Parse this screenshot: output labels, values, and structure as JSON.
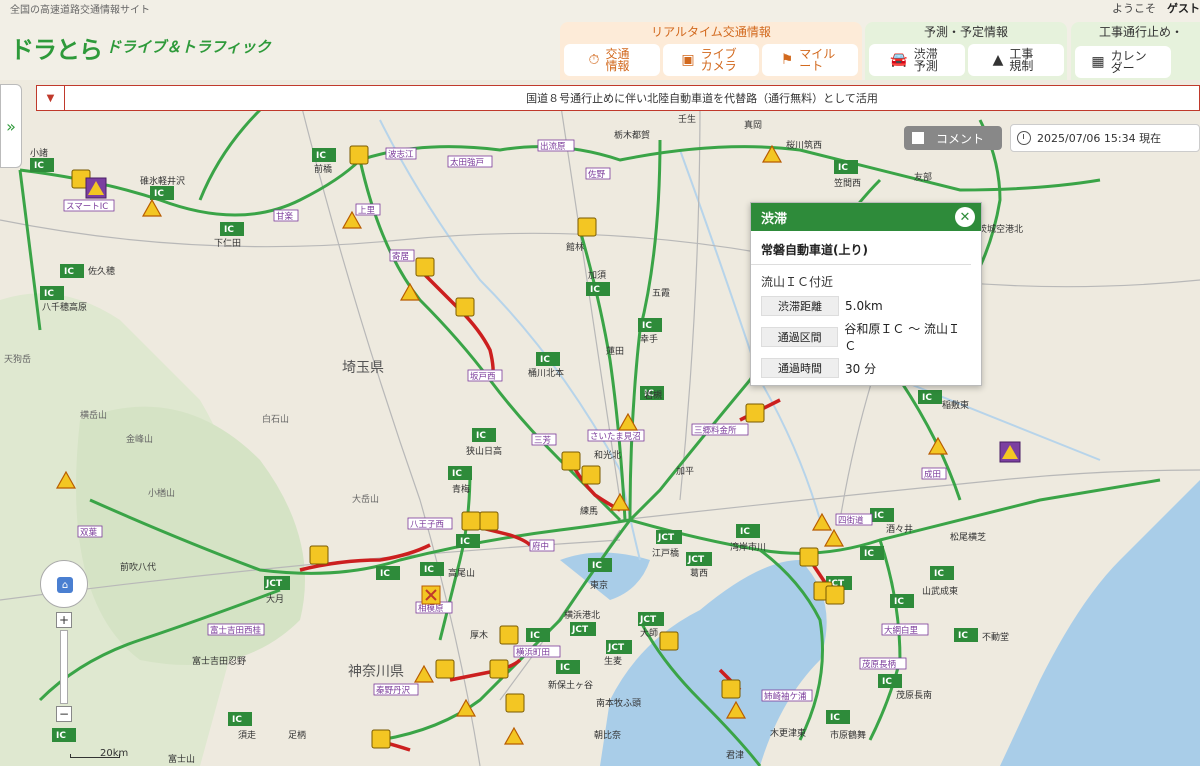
{
  "site": {
    "tagline": "全国の高速道路交通情報サイト",
    "welcome": "ようこそ",
    "guest": "ゲスト",
    "logo": "ドラとら",
    "logo_sub": "ドライブ＆トラフィック"
  },
  "nav": {
    "realtime": {
      "title": "リアルタイム交通情報",
      "items": [
        "交通情報",
        "ライブカメラ",
        "マイルート"
      ]
    },
    "forecast": {
      "title": "予測・予定情報",
      "items": [
        "渋滞予測",
        "工事規制"
      ]
    },
    "closure": {
      "title": "工事通行止め・",
      "items": [
        "カレンダー"
      ]
    }
  },
  "ticker": {
    "text": "国道８号通行止めに伴い北陸自動車道を代替路（通行無料）として活用"
  },
  "controls": {
    "comment_label": "コメント",
    "datetime": "2025/07/06 15:34 現在"
  },
  "popup": {
    "header": "渋滞",
    "road": "常磐自動車道(上り)",
    "location": "流山ＩＣ付近",
    "rows": [
      {
        "key": "渋滞距離",
        "value": "5.0km"
      },
      {
        "key": "通過区間",
        "value": "谷和原ＩＣ 〜 流山ＩＣ"
      },
      {
        "key": "通過時間",
        "value": "30 分"
      }
    ]
  },
  "map": {
    "prefectures": [
      "埼玉県",
      "神奈川県"
    ],
    "scale": "20km",
    "ic_labels": [
      {
        "name": "スマートIC",
        "sub": "PA"
      },
      {
        "name": "波志江",
        "sub": "PA"
      },
      {
        "name": "太田強戸",
        "sub": "PA"
      },
      {
        "name": "出流原",
        "sub": "スマートIC"
      },
      {
        "name": "佐野",
        "sub": "スマートIC"
      },
      {
        "name": "上里",
        "sub": "SA"
      },
      {
        "name": "寄居",
        "sub": "PA"
      },
      {
        "name": "甘楽",
        "sub": "スマートIC"
      },
      {
        "name": "坂戸西",
        "sub": "スマートIC"
      },
      {
        "name": "三芳",
        "sub": "SA"
      },
      {
        "name": "八王子西",
        "sub": ""
      },
      {
        "name": "相模原",
        "sub": ""
      },
      {
        "name": "府中",
        "sub": "スマートIC"
      },
      {
        "name": "横浜町田",
        "sub": ""
      },
      {
        "name": "さいたま見沼",
        "sub": ""
      },
      {
        "name": "三郷料金所",
        "sub": "スマートIC"
      },
      {
        "name": "成田",
        "sub": "スマートIC"
      },
      {
        "name": "四街道",
        "sub": ""
      },
      {
        "name": "大網白里",
        "sub": "スマートIC"
      },
      {
        "name": "茂原長柄",
        "sub": "スマートIC"
      },
      {
        "name": "姉崎袖ケ浦",
        "sub": ""
      },
      {
        "name": "富士吉田西桂",
        "sub": "スマートIC"
      },
      {
        "name": "双葉",
        "sub": "SA"
      },
      {
        "name": "秦野丹沢",
        "sub": "スマートIC"
      },
      {
        "name": "前橋",
        "sub": ""
      },
      {
        "name": "下仁田",
        "sub": ""
      },
      {
        "name": "佐久穂",
        "sub": ""
      },
      {
        "name": "八千穂高原",
        "sub": ""
      },
      {
        "name": "碓氷軽井沢",
        "sub": ""
      },
      {
        "name": "小諸",
        "sub": ""
      },
      {
        "name": "館林",
        "sub": ""
      },
      {
        "name": "加須",
        "sub": ""
      },
      {
        "name": "五霞",
        "sub": ""
      },
      {
        "name": "幸手",
        "sub": ""
      },
      {
        "name": "蓮田",
        "sub": "SA"
      },
      {
        "name": "桶川北本",
        "sub": ""
      },
      {
        "name": "岩槻",
        "sub": ""
      },
      {
        "name": "狭山日高",
        "sub": ""
      },
      {
        "name": "青梅",
        "sub": ""
      },
      {
        "name": "和光北",
        "sub": ""
      },
      {
        "name": "練馬",
        "sub": ""
      },
      {
        "name": "加平",
        "sub": "出入"
      },
      {
        "name": "江戸橋",
        "sub": ""
      },
      {
        "name": "葛西",
        "sub": ""
      },
      {
        "name": "湾岸市川",
        "sub": ""
      },
      {
        "name": "東京",
        "sub": ""
      },
      {
        "name": "高尾山",
        "sub": ""
      },
      {
        "name": "大月",
        "sub": ""
      },
      {
        "name": "厚木",
        "sub": ""
      },
      {
        "name": "横浜港北",
        "sub": ""
      },
      {
        "name": "生麦",
        "sub": ""
      },
      {
        "name": "大師",
        "sub": ""
      },
      {
        "name": "新保土ヶ谷",
        "sub": ""
      },
      {
        "name": "南本牧ふ頭",
        "sub": ""
      },
      {
        "name": "朝比奈",
        "sub": ""
      },
      {
        "name": "木更津東",
        "sub": ""
      },
      {
        "name": "市原鶴舞",
        "sub": ""
      },
      {
        "name": "茂原長南",
        "sub": ""
      },
      {
        "name": "山武成東",
        "sub": ""
      },
      {
        "name": "松尾横芝",
        "sub": ""
      },
      {
        "name": "稲敷東",
        "sub": ""
      },
      {
        "name": "酒々井",
        "sub": ""
      },
      {
        "name": "不動堂",
        "sub": ""
      },
      {
        "name": "君津",
        "sub": ""
      },
      {
        "name": "須走",
        "sub": ""
      },
      {
        "name": "足柄",
        "sub": ""
      },
      {
        "name": "桜川筑西",
        "sub": ""
      },
      {
        "name": "笠間西",
        "sub": ""
      },
      {
        "name": "友部",
        "sub": ""
      },
      {
        "name": "茨城空港北",
        "sub": ""
      },
      {
        "name": "栃木都賀",
        "sub": ""
      },
      {
        "name": "壬生",
        "sub": ""
      },
      {
        "name": "真岡",
        "sub": ""
      },
      {
        "name": "富士吉田忍野",
        "sub": "スマートIC"
      },
      {
        "name": "前吹八代",
        "sub": "スマートIC"
      },
      {
        "name": "富士山",
        "sub": ""
      }
    ],
    "mountains": [
      "白石山",
      "金峰山",
      "横岳山",
      "大岳山",
      "小楢山",
      "天狗岳"
    ]
  }
}
